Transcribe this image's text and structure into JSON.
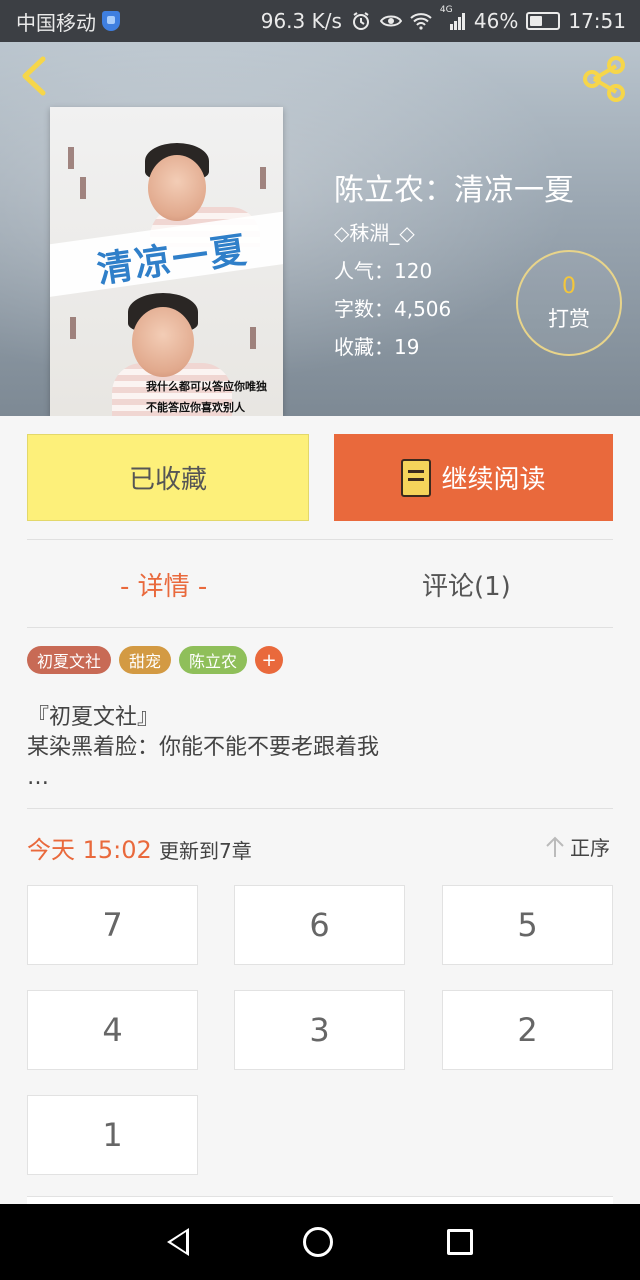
{
  "status_bar": {
    "carrier": "中国移动",
    "speed": "96.3 K/s",
    "network": "4G",
    "battery": "46%",
    "battery_level": 0.46,
    "time": "17:51"
  },
  "book": {
    "title": "陈立农：清凉一夏",
    "author": "◇秣淵_◇",
    "popularity_label": "人气：",
    "popularity": "120",
    "words_label": "字数：",
    "words": "4,506",
    "favorites_label": "收藏：",
    "favorites": "19",
    "cover": {
      "title_text": "清凉一夏",
      "caption_line1": "我什么都可以答应你唯独",
      "caption_line2": "不能答应你喜欢别人"
    }
  },
  "reward": {
    "count": "0",
    "label": "打赏"
  },
  "actions": {
    "favorited_label": "已收藏",
    "continue_label": "继续阅读"
  },
  "tabs": {
    "details": "- 详情 -",
    "comments": "评论(1)"
  },
  "tags": [
    {
      "label": "初夏文社",
      "color": "#c86a55"
    },
    {
      "label": "甜宠",
      "color": "#d39a43"
    },
    {
      "label": "陈立农",
      "color": "#8fbf5a"
    }
  ],
  "tag_add": "+",
  "intro": {
    "line1": "『初夏文社』",
    "line2": "某染黑着脸：你能不能不要老跟着我",
    "line3": "…"
  },
  "update": {
    "time": "今天 15:02",
    "text": "更新到7章",
    "sort_label": "正序"
  },
  "chapters": [
    "7",
    "6",
    "5",
    "4",
    "3",
    "2",
    "1"
  ],
  "colors": {
    "accent": "#e9693c",
    "favorite_button": "#fdf07a",
    "reward_ring": "#e8d48a"
  }
}
